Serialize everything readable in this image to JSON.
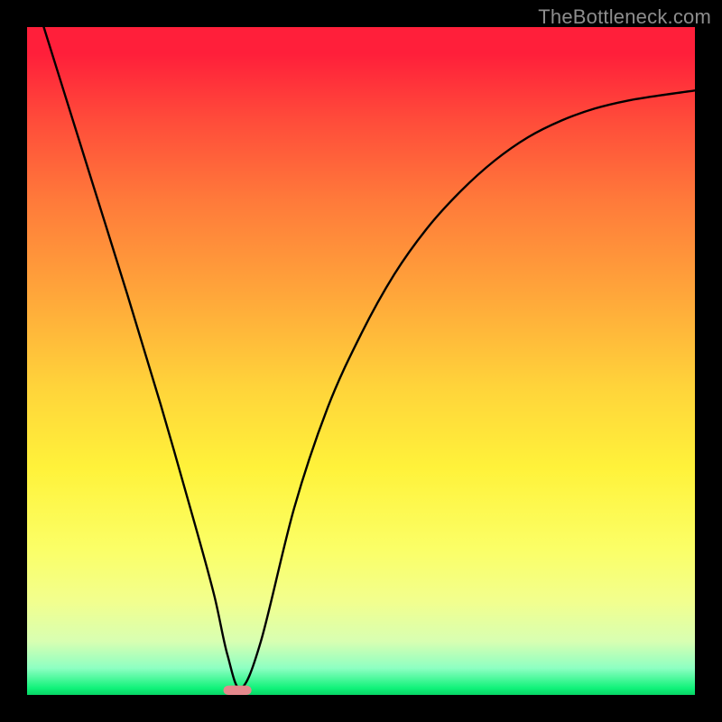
{
  "watermark": "TheBottleneck.com",
  "chart_data": {
    "type": "line",
    "title": "",
    "xlabel": "",
    "ylabel": "",
    "xlim": [
      0,
      1
    ],
    "ylim": [
      0,
      1
    ],
    "background": "red-to-green vertical gradient",
    "series": [
      {
        "name": "bottleneck-curve",
        "x": [
          0.0,
          0.05,
          0.1,
          0.15,
          0.2,
          0.25,
          0.28,
          0.3,
          0.32,
          0.35,
          0.4,
          0.45,
          0.5,
          0.55,
          0.6,
          0.65,
          0.7,
          0.75,
          0.8,
          0.85,
          0.9,
          0.95,
          1.0
        ],
        "values": [
          1.08,
          0.92,
          0.76,
          0.6,
          0.435,
          0.26,
          0.15,
          0.06,
          0.01,
          0.08,
          0.28,
          0.43,
          0.54,
          0.63,
          0.7,
          0.755,
          0.8,
          0.835,
          0.86,
          0.878,
          0.89,
          0.898,
          0.905
        ]
      }
    ],
    "curve_minimum_x": 0.315,
    "marker": {
      "x": 0.315,
      "y": 0.0,
      "width_frac": 0.042,
      "height_frac": 0.014,
      "radius_frac": 0.0075
    }
  }
}
